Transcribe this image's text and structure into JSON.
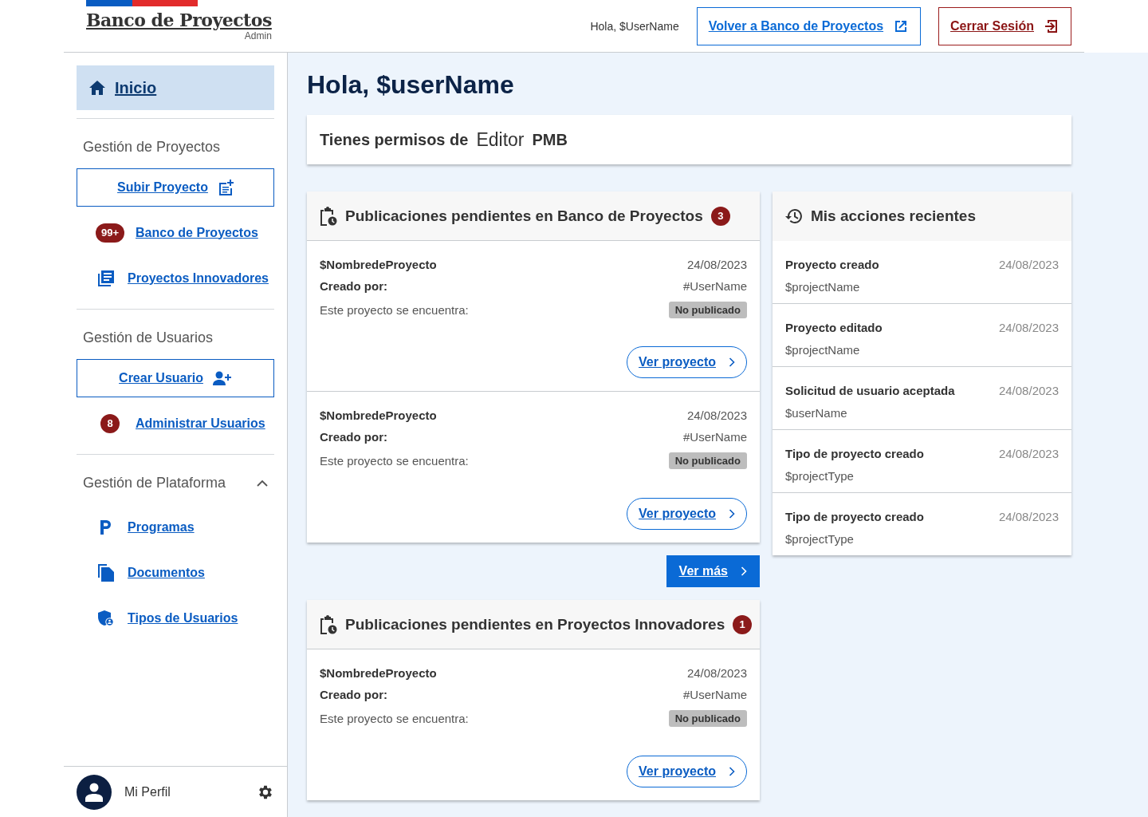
{
  "header": {
    "logo_title": "Banco de Proyectos",
    "logo_subtitle": "Admin",
    "greeting": "Hola, $UserName",
    "back_button": "Volver a Banco de Proyectos",
    "logout_button": "Cerrar Sesión"
  },
  "sidebar": {
    "home": {
      "label": "Inicio",
      "selected": true
    },
    "groups": [
      {
        "title": "Gestión de Proyectos",
        "items": [
          {
            "kind": "button",
            "label": "Subir Proyecto"
          },
          {
            "kind": "badge",
            "badge": "99+",
            "label": "Banco de Proyectos"
          },
          {
            "kind": "icon",
            "label": "Proyectos Innovadores"
          }
        ]
      },
      {
        "title": "Gestión de Usuarios",
        "items": [
          {
            "kind": "button",
            "label": "Crear Usuario"
          },
          {
            "kind": "badge",
            "badge": "8",
            "label": "Administrar Usuarios"
          }
        ]
      },
      {
        "title": "Gestión de Plataforma",
        "expanded": true,
        "items": [
          {
            "kind": "icon",
            "label": "Programas"
          },
          {
            "kind": "icon",
            "label": "Documentos"
          },
          {
            "kind": "icon",
            "label": "Tipos de Usuarios"
          }
        ]
      }
    ],
    "profile": "Mi Perfil"
  },
  "main": {
    "title": "Hola, $userName",
    "permissions": {
      "text": "Tienes permisos de",
      "role": "Editor",
      "scope": "PMB"
    },
    "pending_sections": [
      {
        "title": "Publicaciones pendientes en Banco de Proyectos",
        "count": "3",
        "items": [
          {
            "name": "$NombredeProyecto",
            "date": "24/08/2023",
            "created_label": "Creado por:",
            "creator": "#UserName",
            "status_label": "Este proyecto se encuentra:",
            "status": "No publicado",
            "button": "Ver proyecto"
          },
          {
            "name": "$NombredeProyecto",
            "date": "24/08/2023",
            "created_label": "Creado por:",
            "creator": "#UserName",
            "status_label": "Este proyecto se encuentra:",
            "status": "No publicado",
            "button": "Ver proyecto"
          }
        ],
        "more_button": "Ver más"
      },
      {
        "title": "Publicaciones pendientes en Proyectos Innovadores",
        "count": "1",
        "items": [
          {
            "name": "$NombredeProyecto",
            "date": "24/08/2023",
            "created_label": "Creado por:",
            "creator": "#UserName",
            "status_label": "Este proyecto se encuentra:",
            "status": "No publicado",
            "button": "Ver proyecto"
          }
        ]
      }
    ],
    "recent": {
      "title": "Mis acciones recientes",
      "items": [
        {
          "action": "Proyecto creado",
          "date": "24/08/2023",
          "target": "$projectName"
        },
        {
          "action": "Proyecto editado",
          "date": "24/08/2023",
          "target": "$projectName"
        },
        {
          "action": "Solicitud de usuario aceptada",
          "date": "24/08/2023",
          "target": "$userName"
        },
        {
          "action": "Tipo de proyecto creado",
          "date": "24/08/2023",
          "target": "$projectType"
        },
        {
          "action": "Tipo de proyecto creado",
          "date": "24/08/2023",
          "target": "$projectType"
        }
      ]
    }
  }
}
